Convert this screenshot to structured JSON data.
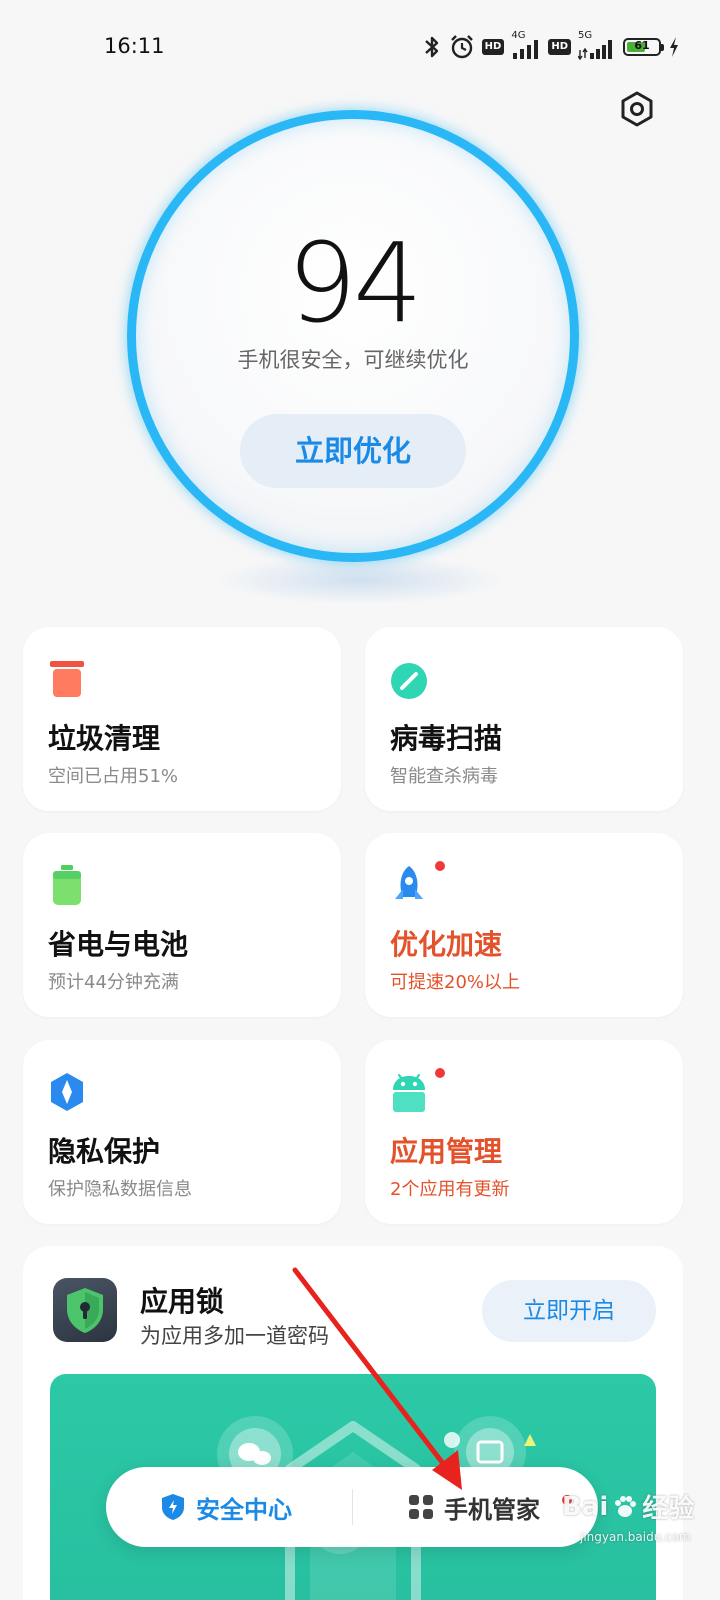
{
  "status_bar": {
    "time": "16:11",
    "network_1": "4G",
    "network_2": "5G",
    "battery_level": "61",
    "battery_fraction": 0.61,
    "icons": [
      "bluetooth-icon",
      "alarm-icon",
      "hd-icon",
      "signal-icon",
      "hd-icon",
      "signal-icon",
      "battery-icon",
      "charging-icon"
    ]
  },
  "score": {
    "value": "94",
    "status": "手机很安全，可继续优化",
    "action_label": "立即优化"
  },
  "cards": [
    {
      "title": "垃圾清理",
      "subtitle": "空间已占用51%",
      "icon": "trash-icon",
      "alert": false
    },
    {
      "title": "病毒扫描",
      "subtitle": "智能查杀病毒",
      "icon": "scan-icon",
      "alert": false
    },
    {
      "title": "省电与电池",
      "subtitle": "预计44分钟充满",
      "icon": "battery-icon",
      "alert": false
    },
    {
      "title": "优化加速",
      "subtitle": "可提速20%以上",
      "icon": "rocket-icon",
      "alert": true
    },
    {
      "title": "隐私保护",
      "subtitle": "保护隐私数据信息",
      "icon": "privacy-icon",
      "alert": false
    },
    {
      "title": "应用管理",
      "subtitle": "2个应用有更新",
      "icon": "android-icon",
      "alert": true
    }
  ],
  "app_lock": {
    "title": "应用锁",
    "subtitle": "为应用多加一道密码",
    "action_label": "立即开启"
  },
  "bottom_nav": {
    "items": [
      {
        "label": "安全中心",
        "icon": "shield-bolt-icon",
        "active": true
      },
      {
        "label": "手机管家",
        "icon": "grid-icon",
        "active": false
      }
    ]
  },
  "watermark": {
    "brand": "Bai",
    "brand_suffix": "经验",
    "url": "jingyan.baidu.com"
  },
  "colors": {
    "accent_blue": "#1a8ae6",
    "ring_blue": "#2ab7f5",
    "alert_red": "#e4522c",
    "dot_red": "#f03a3a",
    "banner_green": "#2cc9a7",
    "background": "#f7f7f7"
  }
}
